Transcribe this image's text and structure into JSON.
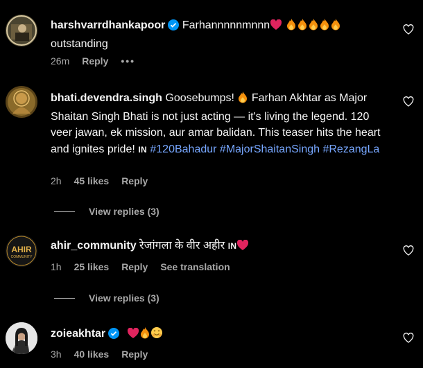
{
  "comments": [
    {
      "username": "harshvarrdhankapoor",
      "verified": true,
      "text_line1": "Farhannnnnmnnn",
      "text_line2": "outstanding",
      "time": "26m",
      "reply_label": "Reply",
      "more_label": "•••"
    },
    {
      "username": "bhati.devendra.singh",
      "verified": false,
      "text_a": "Goosebumps!",
      "text_b": "Farhan Akhtar as Major Shaitan Singh Bhati is not just acting — it's living the legend. 120 veer jawan, ek mission, aur amar balidan. This teaser hits the heart and ignites pride!",
      "in_label": "IN",
      "hashtags": [
        "#120Bahadur",
        "#MajorShaitanSingh",
        "#RezangLa"
      ],
      "time": "2h",
      "likes": "45 likes",
      "reply_label": "Reply",
      "view_replies": "View replies (3)"
    },
    {
      "username": "ahir_community",
      "verified": false,
      "text": "रेजांगला के वीर अहीर",
      "in_label": "IN",
      "avatar_text_top": "AHIR",
      "avatar_text_bottom": "COMMUNITY",
      "time": "1h",
      "likes": "25 likes",
      "reply_label": "Reply",
      "translate_label": "See translation",
      "view_replies": "View replies (3)"
    },
    {
      "username": "zoieakhtar",
      "verified": true,
      "time": "3h",
      "likes": "40 likes",
      "reply_label": "Reply"
    }
  ],
  "colors": {
    "background": "#000000",
    "text": "#f5f5f5",
    "muted": "#a8a8a8",
    "hashtag": "#77a7ff",
    "verified": "#0095f6"
  }
}
